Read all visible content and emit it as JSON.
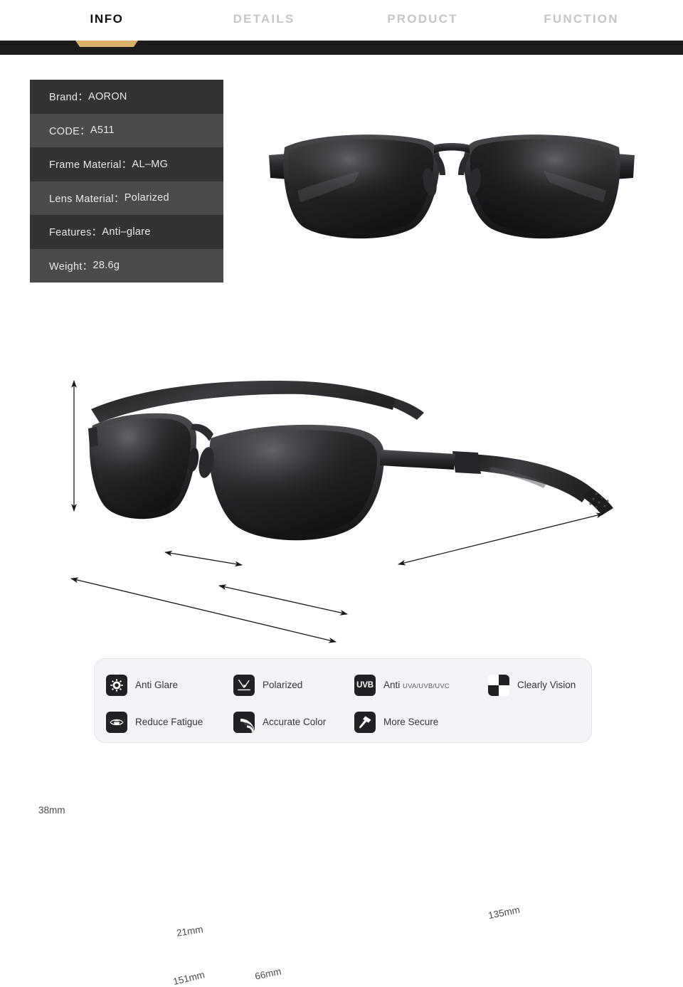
{
  "nav": {
    "tabs": [
      {
        "label": "INFO",
        "active": true
      },
      {
        "label": "DETAILS",
        "active": false
      },
      {
        "label": "PRODUCT",
        "active": false
      },
      {
        "label": "FUNCTION",
        "active": false
      }
    ],
    "accent_color": "#d9b268",
    "bar_color": "#1c1c1c"
  },
  "spec": {
    "rows": [
      {
        "label": "Brand：",
        "value": "AORON"
      },
      {
        "label": "CODE：",
        "value": "A511"
      },
      {
        "label": "Frame Material：",
        "value": "AL–MG"
      },
      {
        "label": "Lens Material：",
        "value": "Polarized"
      },
      {
        "label": "Features：",
        "value": "Anti–glare"
      },
      {
        "label": "Weight：",
        "value": "28.6g"
      }
    ],
    "row_dark_color": "#333336",
    "row_light_color": "#4b4b4e"
  },
  "hero": {
    "alt": "sunglasses-front-view"
  },
  "dimensions": {
    "alt": "sunglasses-angled-view",
    "labels": [
      {
        "key": "height",
        "text": "38mm"
      },
      {
        "key": "lens_height",
        "text": "21mm"
      },
      {
        "key": "total_width",
        "text": "151mm"
      },
      {
        "key": "lens_width",
        "text": "66mm"
      },
      {
        "key": "temple_length",
        "text": "135mm"
      }
    ]
  },
  "features": {
    "row1": [
      {
        "icon": "sun-icon",
        "text": "Anti Glare",
        "sub": ""
      },
      {
        "icon": "polarized-arrow-icon",
        "text": "Polarized",
        "sub": ""
      },
      {
        "icon": "uvb-icon",
        "icon_text": "UVB",
        "text": "Anti",
        "sub": "UVA/UVB/UVC"
      },
      {
        "icon": "checkerboard-icon",
        "text": "Clearly Vision",
        "sub": ""
      }
    ],
    "row2": [
      {
        "icon": "eye-icon",
        "text": "Reduce Fatigue",
        "sub": ""
      },
      {
        "icon": "color-rings-icon",
        "text": "Accurate Color",
        "sub": ""
      },
      {
        "icon": "hammer-icon",
        "text": "More Secure",
        "sub": ""
      }
    ],
    "panel_color": "#f2f4f7"
  }
}
